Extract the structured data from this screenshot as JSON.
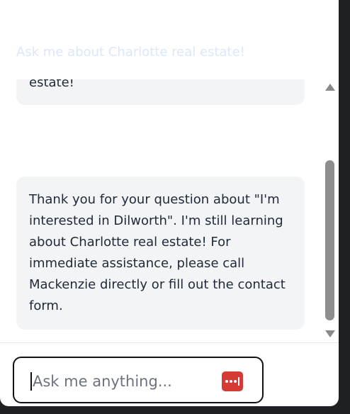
{
  "chat": {
    "hint": "Ask me about Charlotte real estate!",
    "messages": [
      {
        "text": "estate!"
      },
      {
        "text": "Thank you for your question about \"I'm interested in Dilworth\". I'm still learning about Charlotte real estate! For immediate assistance, please call Mackenzie directly or fill out the contact form."
      }
    ]
  },
  "input": {
    "placeholder": "Ask me anything..."
  },
  "icons": {
    "send": "password-dots-icon"
  },
  "colors": {
    "accent": "#d63a34",
    "bubble": "#f3f4f6",
    "hint": "#dbe7fb"
  }
}
